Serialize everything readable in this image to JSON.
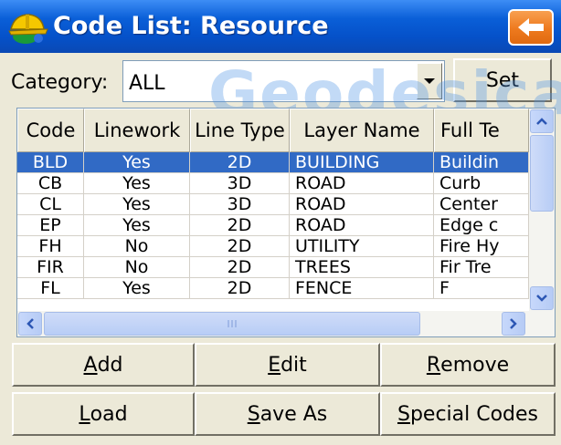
{
  "window": {
    "title": "Code List: Resource",
    "title_color": "#0551c9",
    "back_button_color": "#ee7a1e"
  },
  "category": {
    "label": "Category:",
    "selected": "ALL",
    "set_label": "Set"
  },
  "watermark": "Geodesical",
  "table": {
    "columns": [
      "Code",
      "Linework",
      "Line Type",
      "Layer Name",
      "Full Te"
    ],
    "rows": [
      {
        "code": "BLD",
        "linework": "Yes",
        "line_type": "2D",
        "layer": "BUILDING",
        "full": "Buildin",
        "selected": true
      },
      {
        "code": "CB",
        "linework": "Yes",
        "line_type": "3D",
        "layer": "ROAD",
        "full": "Curb"
      },
      {
        "code": "CL",
        "linework": "Yes",
        "line_type": "3D",
        "layer": "ROAD",
        "full": "Center"
      },
      {
        "code": "EP",
        "linework": "Yes",
        "line_type": "2D",
        "layer": "ROAD",
        "full": "Edge c"
      },
      {
        "code": "FH",
        "linework": "No",
        "line_type": "2D",
        "layer": "UTILITY",
        "full": "Fire Hy"
      },
      {
        "code": "FIR",
        "linework": "No",
        "line_type": "2D",
        "layer": "TREES",
        "full": "Fir Tre"
      },
      {
        "code": "FL",
        "linework": "Yes",
        "line_type": "2D",
        "layer": "FENCE",
        "full": "F"
      }
    ],
    "selection_color": "#316ac5"
  },
  "buttons": {
    "add": {
      "pre": "",
      "u": "A",
      "post": "dd"
    },
    "edit": {
      "pre": "",
      "u": "E",
      "post": "dit"
    },
    "remove": {
      "pre": "",
      "u": "R",
      "post": "emove"
    },
    "load": {
      "pre": "",
      "u": "L",
      "post": "oad"
    },
    "save_as": {
      "pre": "",
      "u": "S",
      "post": "ave As"
    },
    "special": {
      "pre": "",
      "u": "S",
      "post": "pecial Codes"
    }
  }
}
